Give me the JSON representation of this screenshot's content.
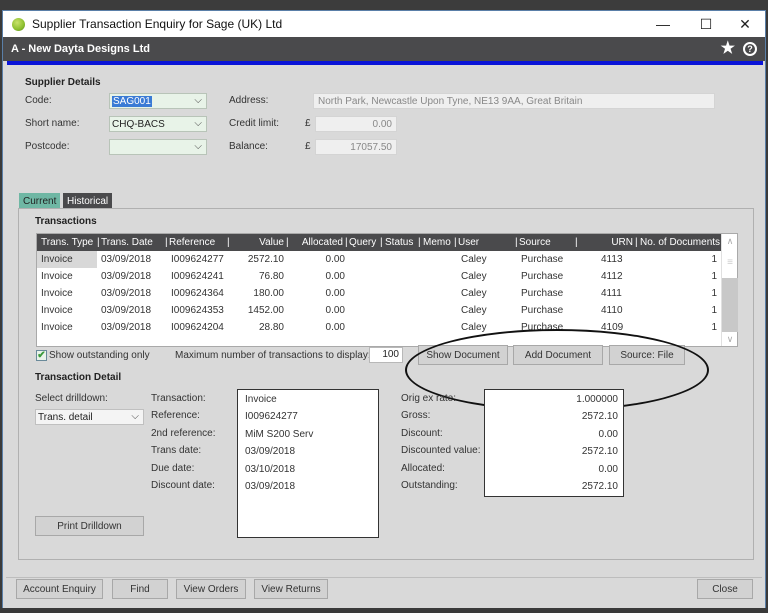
{
  "window": {
    "title": "Supplier Transaction Enquiry for Sage (UK) Ltd",
    "company": "A - New Dayta Designs Ltd",
    "controls": {
      "minimize": "—",
      "maximize": "☐",
      "close": "✕"
    },
    "header_icons": {
      "favourite": "★",
      "help": "?"
    }
  },
  "supplier_details": {
    "heading": "Supplier Details",
    "code_label": "Code:",
    "code_value": "SAG001",
    "short_name_label": "Short name:",
    "short_name_value": "CHQ-BACS",
    "postcode_label": "Postcode:",
    "postcode_value": "",
    "address_label": "Address:",
    "address_value": "North Park, Newcastle Upon Tyne, NE13 9AA, Great Britain",
    "credit_limit_label": "Credit limit:",
    "credit_limit_currency": "£",
    "credit_limit_value": "0.00",
    "balance_label": "Balance:",
    "balance_currency": "£",
    "balance_value": "17057.50"
  },
  "tabs": [
    {
      "label": "Current",
      "active": true
    },
    {
      "label": "Historical",
      "active": false
    }
  ],
  "transactions": {
    "heading": "Transactions",
    "columns": [
      "Trans. Type",
      "Trans. Date",
      "Reference",
      "Value",
      "Allocated",
      "Query",
      "Status",
      "Memo",
      "User",
      "Source",
      "URN",
      "No. of Documents"
    ],
    "rows": [
      {
        "type": "Invoice",
        "date": "03/09/2018",
        "reference": "I009624277",
        "value": "2572.10",
        "allocated": "0.00",
        "query": "",
        "status": "",
        "memo": "",
        "user": "Caley",
        "source": "Purchase",
        "urn": "4113",
        "docs": "1"
      },
      {
        "type": "Invoice",
        "date": "03/09/2018",
        "reference": "I009624241",
        "value": "76.80",
        "allocated": "0.00",
        "query": "",
        "status": "",
        "memo": "",
        "user": "Caley",
        "source": "Purchase",
        "urn": "4112",
        "docs": "1"
      },
      {
        "type": "Invoice",
        "date": "03/09/2018",
        "reference": "I009624364",
        "value": "180.00",
        "allocated": "0.00",
        "query": "",
        "status": "",
        "memo": "",
        "user": "Caley",
        "source": "Purchase",
        "urn": "4111",
        "docs": "1"
      },
      {
        "type": "Invoice",
        "date": "03/09/2018",
        "reference": "I009624353",
        "value": "1452.00",
        "allocated": "0.00",
        "query": "",
        "status": "",
        "memo": "",
        "user": "Caley",
        "source": "Purchase",
        "urn": "4110",
        "docs": "1"
      },
      {
        "type": "Invoice",
        "date": "03/09/2018",
        "reference": "I009624204",
        "value": "28.80",
        "allocated": "0.00",
        "query": "",
        "status": "",
        "memo": "",
        "user": "Caley",
        "source": "Purchase",
        "urn": "4109",
        "docs": "1"
      }
    ],
    "show_outstanding_label": "Show outstanding only",
    "show_outstanding_checked": true,
    "max_transactions_label": "Maximum number of transactions to display:",
    "max_transactions_value": "100",
    "show_document_button": "Show Document",
    "add_document_button": "Add Document",
    "source_button": "Source: File"
  },
  "transaction_detail": {
    "heading": "Transaction Detail",
    "select_drilldown_label": "Select drilldown:",
    "drilldown_value": "Trans. detail",
    "left_labels": [
      "Transaction:",
      "Reference:",
      "2nd reference:",
      "Trans date:",
      "Due date:",
      "Discount date:"
    ],
    "left_values": [
      "Invoice",
      "I009624277",
      "MiM S200 Serv",
      "03/09/2018",
      "03/10/2018",
      "03/09/2018"
    ],
    "right_labels": [
      "Orig ex rate:",
      "Gross:",
      "Discount:",
      "Discounted value:",
      "Allocated:",
      "Outstanding:"
    ],
    "right_values": [
      "1.000000",
      "2572.10",
      "0.00",
      "2572.10",
      "0.00",
      "2572.10"
    ],
    "print_drilldown_button": "Print Drilldown"
  },
  "footer": {
    "account_enquiry": "Account Enquiry",
    "find": "Find",
    "view_orders": "View Orders",
    "view_returns": "View Returns",
    "close": "Close"
  }
}
